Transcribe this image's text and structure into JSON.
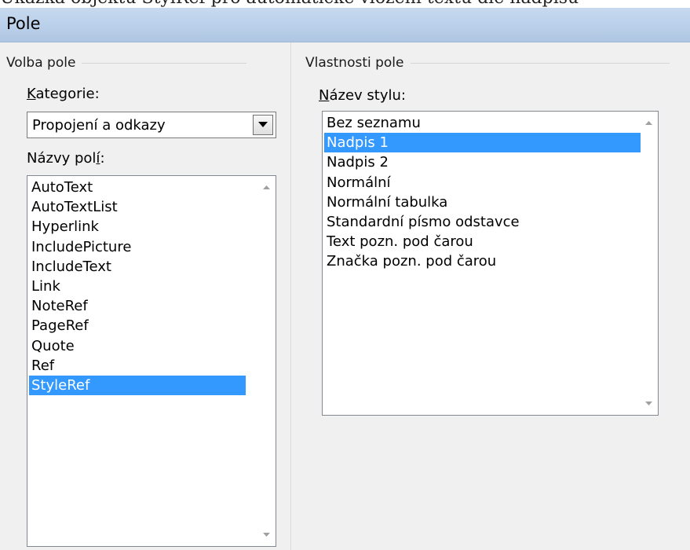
{
  "top_caption": "Ukázka objektu StylRef pro automatické vložení textu dle nadpisu",
  "window": {
    "title": "Pole"
  },
  "left": {
    "group_title": "Volba pole",
    "category": {
      "label_u": "K",
      "label_rest": "ategorie:",
      "value": "Propojení a odkazy"
    },
    "field_names": {
      "label_pre": "Názvy pol",
      "label_u": "í",
      "label_post": ":",
      "items": [
        "AutoText",
        "AutoTextList",
        "Hyperlink",
        "IncludePicture",
        "IncludeText",
        "Link",
        "NoteRef",
        "PageRef",
        "Quote",
        "Ref",
        "StyleRef"
      ],
      "selected_index": 10
    }
  },
  "right": {
    "group_title": "Vlastnosti pole",
    "style_name": {
      "label_u": "N",
      "label_rest": "ázev stylu:",
      "items": [
        "Bez seznamu",
        "Nadpis 1",
        "Nadpis 2",
        "Normální",
        "Normální tabulka",
        "Standardní písmo odstavce",
        "Text pozn. pod čarou",
        "Značka pozn. pod čarou"
      ],
      "selected_index": 1
    }
  },
  "colors": {
    "selection": "#3399ff",
    "titlebar": "#b9cfe9"
  },
  "icons": {
    "dropdown": "triangle-down-icon",
    "scroll_up": "scroll-up-arrow-icon",
    "scroll_down": "scroll-down-arrow-icon"
  }
}
